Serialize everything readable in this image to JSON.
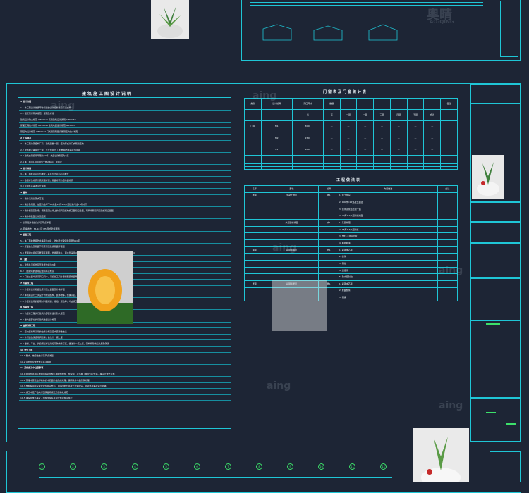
{
  "notes_panel": {
    "title": "建筑施工图设计说明",
    "lines": [
      "1   设计依据",
      "1.1 本工程设计依据甲方提供的设计任务书及有关文件",
      "1.2 国家现行有关规范、规程及标准",
      "    建筑设计防火规范 GB50016              民用建筑设计通则 GB50352",
      "    屋面工程技术规范 GB50345              建筑地面设计规范 GB50037",
      "    钢结构设计规范 GB50017               门式刚架轻型房屋钢结构技术规程",
      "2   工程概况",
      "2.1 本工程为钢结构厂房，建筑层数一层，结构形式为门式刚架结构",
      "2.2 建筑耐火等级为二级，生产类别为丁类     屋面防水等级为III级",
      "2.3 建筑合理使用年限为50年，抗震设防烈度为7度",
      "2.4 本工程±0.000相当于绝对标高，现场定",
      "3   设计标高",
      "3.1 本工程标高以m为单位，其余尺寸以mm为单位",
      "3.2 各层标注标高为完成面标高，屋面标高为结构面标高",
      "3.3 室内外高差详见立面图",
      "4   墙体",
      "4.1 墙体采用彩钢夹芯板",
      "4.2 墙身防潮层：在室内地坪下60处做20厚1:2水泥砂浆内加5%防水剂",
      "4.3 墙体留洞及封堵：钢筋混凝土墙上的留洞见结构施工图和设备图，砌筑墙预留洞见建施和设备图",
      "4.4 墙体基础部分详见结施",
      "    1. 彩钢板外墙做法详见节点详图",
      "    2. 砖墙做法：MU10 砖 M5 混合砂浆砌筑",
      "5   屋面工程",
      "5.1 本工程的屋面防水等级为III级，防水层合理使用年限为10年",
      "5.2 屋面做法及屋面节点索引见建施屋面平面图",
      "5.3 屋面排水组织见屋面平面图，外排雨水斗、雨水管采用UPVC管材，除图中另有注明者外雨水管的公称直径均为DN100",
      "6   门窗",
      "6.1 建筑外门窗抗风压性能分级为3级",
      "6.2 门窗玻璃的选用应遵照有关规定",
      "6.3 门窗立面均表示洞口尺寸，门窗加工尺寸要按照装修面厚度由承包商予以调整",
      "7   外装修工程",
      "7.1 外装修设计和做法索引见立面图及外墙详图",
      "7.2 承包商进行二次设计的轻钢结构、装饰物等，经确认后，向建筑设计单位提供预埋件的设置要求",
      "7.3 外装修选用的各项材料其材质、规格、颜色等，均由施工单位提供样板，经建设和设计单位确认",
      "8   内装修工程",
      "8.1 内装修工程执行建筑内部装修设计防火规范",
      "8.2 楼地面部分执行建筑地面设计规范",
      "9   油漆涂料工程",
      "9.1 室内装修所采用的油漆涂料见室内装修做法表",
      "9.2 木门窗油漆选用调和漆，做法为一底二度",
      "9.3 楼梯、平台、护窗钢栏杆选用红丹防锈漆打底，做法为一底二度，钢构件除锈后先刷防锈漆",
      "10  室外工程",
      "10.1 散水、坡道做法详见节点详图",
      "10.2 室外台阶做法详见总平面图",
      "11  其他施工中注意事项",
      "11.1 图中所选用标准图中有对结构工种的预埋件、预留洞，应与各工种密切配合后，确认无误方可施工",
      "11.2 预埋木砖及贴邻墙体的木质面均做防腐处理，露明铁件均做防锈处理",
      "11.3 楼板留洞待设备管线安装完毕后，用C20细石混凝土封堵密实，管道竖井每层进行封堵",
      "11.4 施工中应严格执行国家各项施工质量验收规范",
      "11.5 本说明未尽事宜，均按国家有关现行规范规定执行"
    ]
  },
  "door_table": {
    "title": "门窗表及门窗统计表",
    "header": [
      "类别",
      "设计编号",
      "洞口尺寸",
      "数量",
      "",
      "",
      "",
      "",
      "",
      "",
      "备注"
    ],
    "subheader": [
      "",
      "",
      "宽",
      "高",
      "一层",
      "二层",
      "三层",
      "四层",
      "五层",
      "合计",
      ""
    ],
    "rows": [
      [
        "门窗",
        "M1",
        "3000",
        "—",
        "—",
        "—",
        "—",
        "—",
        "—",
        "—",
        ""
      ],
      [
        "",
        "M2",
        "1500",
        "—",
        "—",
        "—",
        "—",
        "—",
        "—",
        "—",
        ""
      ],
      [
        "",
        "C1",
        "1800",
        "—",
        "—",
        "—",
        "—",
        "—",
        "—",
        "—",
        ""
      ]
    ]
  },
  "finish_table": {
    "title": "工程做法表",
    "header": [
      "名称",
      "部位",
      "编号",
      "构造做法",
      "备注"
    ],
    "rows": [
      [
        "地面",
        "混凝土地面",
        "地1",
        "1. 素土夯实"
      ],
      [
        "",
        "",
        "",
        "2. 100厚C15混凝土垫层"
      ],
      [
        "",
        "",
        "",
        "3. 素水泥浆结合层一遍"
      ],
      [
        "",
        "",
        "",
        "4. 20厚1:2水泥砂浆抹面"
      ],
      [
        "",
        "水泥砂浆墙面",
        "内1",
        "1. 基层处理"
      ],
      [
        "",
        "",
        "",
        "2. 15厚1:3水泥砂浆"
      ],
      [
        "",
        "",
        "",
        "3. 5厚1:2水泥砂浆"
      ],
      [
        "",
        "",
        "",
        "4. 刷乳胶漆"
      ],
      [
        "墙面",
        "彩钢板墙面",
        "外1",
        "1. 彩钢夹芯板"
      ],
      [
        "",
        "",
        "",
        "2. 檩条"
      ],
      [
        "",
        "",
        "",
        "3. 钢柱"
      ],
      [
        "",
        "",
        "",
        "4. 连接件"
      ],
      [
        "",
        "",
        "",
        "5. 防水密封胶"
      ],
      [
        "屋面",
        "彩钢板屋面",
        "屋1",
        "1. 彩钢夹芯板"
      ],
      [
        "",
        "",
        "",
        "2. 屋面檩条"
      ],
      [
        "",
        "",
        "",
        "3. 钢梁"
      ]
    ]
  },
  "watermarks": [
    "奥晴",
    "AO-QING",
    "aing",
    "aing",
    "aing",
    "aing",
    "aing",
    "aing"
  ],
  "axis_labels": [
    "1",
    "2",
    "3",
    "4",
    "5",
    "6",
    "7",
    "8",
    "9",
    "10",
    "11",
    "12"
  ],
  "colors": {
    "background": "#1d2535",
    "frame": "#1fc6d6",
    "text": "#e4ecef",
    "accent_green": "#3ce06a"
  }
}
